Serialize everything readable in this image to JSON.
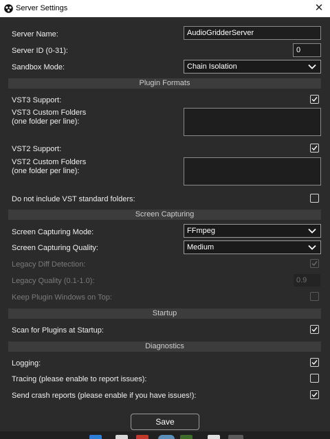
{
  "window": {
    "title": "Server Settings",
    "close_glyph": "✕",
    "app_icon": "audiogridder-icon"
  },
  "fields": {
    "server_name": {
      "label": "Server Name:",
      "value": "AudioGridderServer"
    },
    "server_id": {
      "label": "Server ID (0-31):",
      "value": "0"
    },
    "sandbox_mode": {
      "label": "Sandbox Mode:",
      "value": "Chain Isolation"
    }
  },
  "sections": {
    "plugin_formats": "Plugin Formats",
    "screen_capturing": "Screen Capturing",
    "startup": "Startup",
    "diagnostics": "Diagnostics"
  },
  "plugin_formats": {
    "vst3_support": {
      "label": "VST3 Support:",
      "checked": true
    },
    "vst3_folders": {
      "label": "VST3 Custom Folders\n(one folder per line):",
      "value": ""
    },
    "vst2_support": {
      "label": "VST2 Support:",
      "checked": true
    },
    "vst2_folders": {
      "label": "VST2 Custom Folders\n(one folder per line):",
      "value": ""
    },
    "no_vst_standard": {
      "label": "Do not include VST standard folders:",
      "checked": false
    }
  },
  "screen_capturing": {
    "mode": {
      "label": "Screen Capturing Mode:",
      "value": "FFmpeg"
    },
    "quality": {
      "label": "Screen Capturing Quality:",
      "value": "Medium"
    },
    "legacy_diff": {
      "label": "Legacy Diff Detection:",
      "checked": true,
      "enabled": false
    },
    "legacy_quality": {
      "label": "Legacy Quality (0.1-1.0):",
      "value": "0.9",
      "enabled": false
    },
    "keep_on_top": {
      "label": "Keep Plugin Windows on Top:",
      "checked": false,
      "enabled": false
    }
  },
  "startup": {
    "scan_plugins": {
      "label": "Scan for Plugins at Startup:",
      "checked": true
    }
  },
  "diagnostics": {
    "logging": {
      "label": "Logging:",
      "checked": true
    },
    "tracing": {
      "label": "Tracing (please enable to report issues):",
      "checked": false
    },
    "crash_reports": {
      "label": "Send crash reports (please enable if you have issues!):",
      "checked": true
    }
  },
  "actions": {
    "save_label": "Save"
  },
  "colors": {
    "background": "#2b2b2b",
    "section": "#3c3c3c",
    "field": "#1e1e1e",
    "text": "#f0f0f0",
    "disabled_text": "#7a7a7a"
  }
}
